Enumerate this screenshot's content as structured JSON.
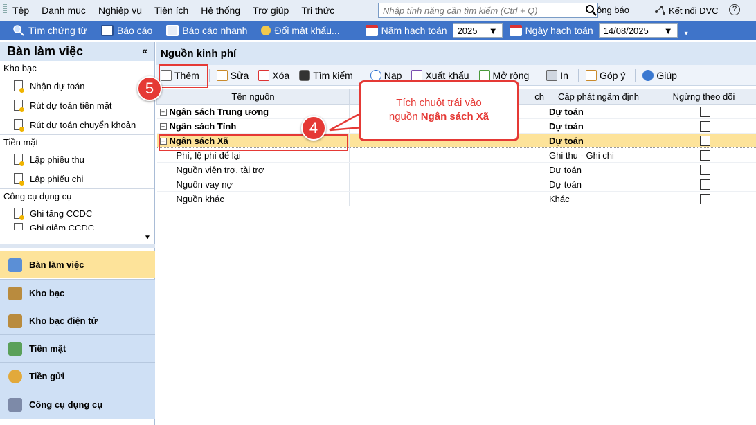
{
  "menubar": {
    "items": [
      "Tệp",
      "Danh mục",
      "Nghiệp vụ",
      "Tiện ích",
      "Hệ thống",
      "Trợ giúp",
      "Tri thức"
    ],
    "search_placeholder": "Nhập tính năng cần tìm kiếm (Ctrl + Q)",
    "notify": "ông báo",
    "dvc": "Kết nối DVC",
    "help": "?"
  },
  "toolbar": {
    "items": [
      "Tìm chứng từ",
      "Báo cáo",
      "Báo cáo nhanh",
      "Đổi mật khẩu..."
    ],
    "year_label": "Năm hạch toán",
    "year_value": "2025",
    "date_label": "Ngày hạch toán",
    "date_value": "14/08/2025"
  },
  "left": {
    "title": "Bàn làm việc",
    "collapse": "«",
    "groups": [
      {
        "label": "Kho bạc",
        "items": [
          "Nhận dự toán",
          "Rút dự toán tiền mặt",
          "Rút dự toán chuyển khoản"
        ]
      },
      {
        "label": "Tiền mặt",
        "items": [
          "Lập phiếu thu",
          "Lập phiếu chi"
        ]
      },
      {
        "label": "Công cụ dụng cụ",
        "items": [
          "Ghi tăng CCDC",
          "Ghi giảm CCDC"
        ]
      }
    ],
    "nav": [
      "Bàn làm việc",
      "Kho bạc",
      "Kho bạc điện tử",
      "Tiền mặt",
      "Tiền gửi",
      "Công cụ dụng cụ"
    ]
  },
  "main": {
    "title": "Nguồn kinh phí",
    "actions": [
      "Thêm",
      "Sửa",
      "Xóa",
      "Tìm kiếm",
      "Nạp",
      "Xuất khẩu",
      "Mở rộng",
      "In",
      "Góp ý",
      "Giúp"
    ],
    "columns": [
      "Tên nguồn",
      "",
      "ch",
      "Cấp phát ngầm định",
      "Ngừng theo dõi"
    ],
    "rows": [
      {
        "name": "Ngân sách Trung ương",
        "cap": "Dự toán"
      },
      {
        "name": "Ngân sách Tỉnh",
        "cap": "Dự toán"
      },
      {
        "name": "Ngân sách Xã",
        "cap": "Dự toán"
      },
      {
        "name": "Phí, lệ phí để lại",
        "cap": "Ghi thu - Ghi chi"
      },
      {
        "name": "Nguồn viện trợ, tài trợ",
        "cap": "Dự toán"
      },
      {
        "name": "Nguồn vay nợ",
        "cap": "Dự toán"
      },
      {
        "name": "Nguồn khác",
        "cap": "Khác"
      }
    ]
  },
  "annotations": {
    "badge5": "5",
    "badge4": "4",
    "callout_line1": "Tích chuột trái vào",
    "callout_line2": "nguồn",
    "callout_bold": "Ngân sách Xã"
  },
  "colors": {
    "toolbar": "#3f74c9",
    "selected_row": "#fde39a",
    "highlight": "#e53935"
  }
}
